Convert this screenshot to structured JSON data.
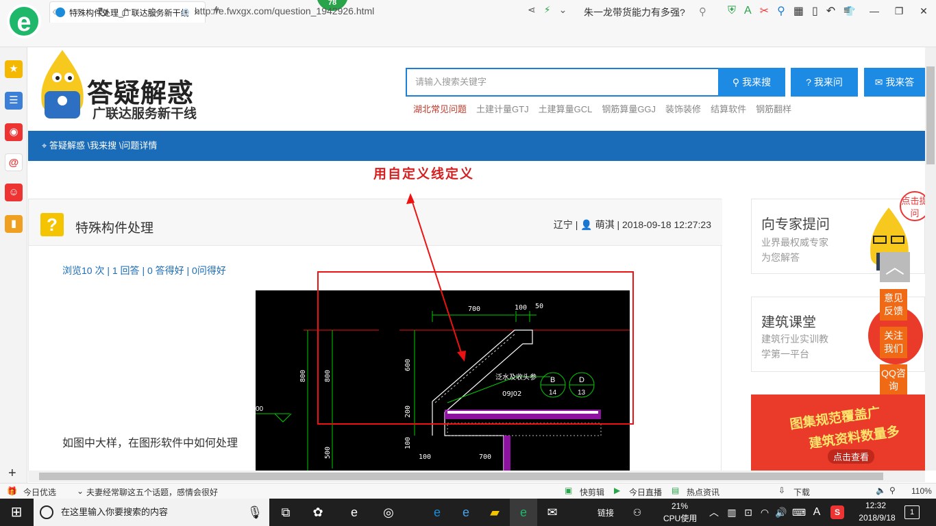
{
  "browser": {
    "tab_title": "特殊构件处理_广联达服务新干线",
    "tab_close": "×",
    "new_tab": "+",
    "badge": "78",
    "url": "http://e.fwxgx.com/question_1942926.html",
    "news_search": "朱一龙带货能力有多强?",
    "logo_letter": "e"
  },
  "header": {
    "logo_title": "答疑解惑",
    "logo_subtitle": "广联达服务新干线",
    "search_placeholder": "请输入搜索关键字",
    "search_button": "我来搜",
    "ask_button": "我来问",
    "answer_button": "我来答",
    "hot_links": [
      "湖北常见问题",
      "土建计量GTJ",
      "土建算量GCL",
      "钢筋算量GGJ",
      "装饰装修",
      "结算软件",
      "钢筋翻样"
    ]
  },
  "breadcrumb": "答疑解惑 \\我来搜 \\问题详情",
  "annotation_label": "用自定义线定义",
  "question": {
    "title": "特殊构件处理",
    "region": "辽宁",
    "user": "萌淇",
    "datetime": "2018-09-18 12:27:23",
    "stats": "浏览10 次 | 1 回答 | 0 答得好 | 0问得好",
    "body": "如图中大样，在图形软件中如何处理"
  },
  "cad": {
    "dims": [
      "700",
      "100",
      "50",
      "600",
      "800",
      "800",
      "200",
      "100",
      "500",
      "100",
      "700"
    ],
    "note1": "泛水及收头参",
    "note2": "09J02",
    "circle_b": "B",
    "circle_b_num": "14",
    "circle_d": "D",
    "circle_d_num": "13",
    "left_val": "00"
  },
  "sidebar": {
    "expert_title": "向专家提问",
    "expert_sub1": "业界最权威专家",
    "expert_sub2": "为您解答",
    "click_ask": "点击提问",
    "course_title": "建筑课堂",
    "course_sub1": "建筑行业实训教",
    "course_sub2": "学第一平台",
    "feedback": "意见反馈",
    "follow": "关注我们",
    "qq": "QQ咨询",
    "back_top": "︿",
    "banner_line1": "图集规范覆盖广",
    "banner_line2": "建筑资料数量多",
    "banner_btn": "点击查看"
  },
  "statusbar": {
    "today": "今日优选",
    "headline": "夫妻经常聊这五个话题，感情会很好",
    "clip": "快剪辑",
    "live": "今日直播",
    "hot": "热点资讯",
    "download": "下载",
    "zoom": "110%"
  },
  "taskbar": {
    "search_placeholder": "在这里输入你要搜索的内容",
    "link": "链接",
    "cpu_pct": "21%",
    "cpu_label": "CPU使用",
    "ime": "A",
    "time": "12:32",
    "date": "2018/9/18",
    "notif": "1"
  },
  "colors": {
    "accent": "#1a6bb8",
    "button": "#1d8ae4",
    "annotation": "#d42020",
    "orange": "#f06a15"
  }
}
